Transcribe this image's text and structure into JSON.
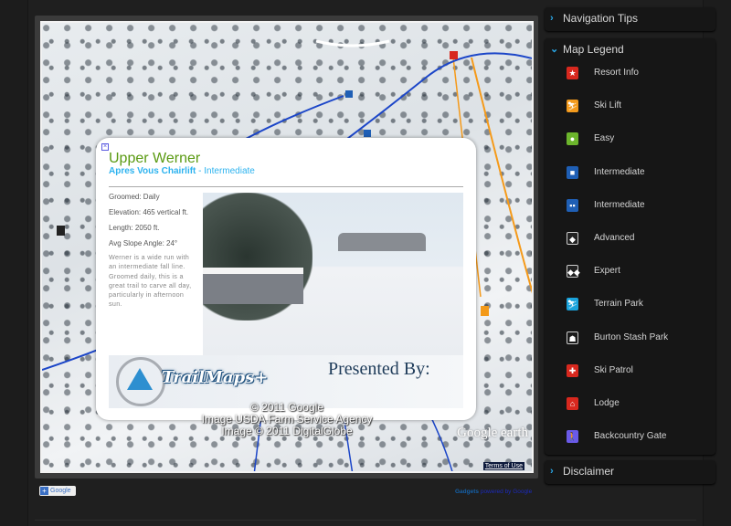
{
  "map": {
    "popup": {
      "close_icon": "close-icon",
      "title": "Upper Werner",
      "lift": "Apres Vous Chairlift",
      "separator": " - ",
      "difficulty": "Intermediate",
      "facts": [
        "Groomed: Daily",
        "Elevation: 465 vertical ft.",
        "Length: 2050 ft.",
        "Avg Slope Angle: 24°"
      ],
      "description": "Werner is a wide run with an intermediate fall line. Groomed daily, this is a great trail to carve all day, particularly in afternoon sun.",
      "banner_logo": "TrailMaps+",
      "presented_by": "Presented By:"
    },
    "attribution": [
      "© 2011 Google",
      "Image USDA Farm Service Agency",
      "Image © 2011 DigitalGlobe"
    ],
    "watermark": "Google earth",
    "terms": "Terms of Use"
  },
  "footer": {
    "add_google": "Google",
    "gadgets": "Gadgets",
    "powered": "powered by Google"
  },
  "sidebar": {
    "navigation_tips": "Navigation Tips",
    "legend_title": "Map Legend",
    "legend": [
      {
        "label": "Resort Info",
        "icon": "star-icon",
        "color": "#d8281e",
        "glyph": "★"
      },
      {
        "label": "Ski Lift",
        "icon": "ski-lift-icon",
        "color": "#f39a1c",
        "glyph": "⛷"
      },
      {
        "label": "Easy",
        "icon": "green-circle-icon",
        "color": "#6cb52c",
        "glyph": "●"
      },
      {
        "label": "Intermediate",
        "icon": "blue-square-icon",
        "color": "#1f5fb5",
        "glyph": "■"
      },
      {
        "label": "Intermediate",
        "icon": "double-blue-square-icon",
        "color": "#1f5fb5",
        "glyph": "▪▪"
      },
      {
        "label": "Advanced",
        "icon": "black-diamond-icon",
        "color": "#222222",
        "glyph": "◆"
      },
      {
        "label": "Expert",
        "icon": "double-black-diamond-icon",
        "color": "#222222",
        "glyph": "◆◆"
      },
      {
        "label": "Terrain Park",
        "icon": "terrain-park-icon",
        "color": "#1aa3dc",
        "glyph": "⛷"
      },
      {
        "label": "Burton Stash Park",
        "icon": "burton-stash-icon",
        "color": "#1a1a1a",
        "glyph": "☗"
      },
      {
        "label": "Ski Patrol",
        "icon": "ski-patrol-icon",
        "color": "#d8281e",
        "glyph": "✚"
      },
      {
        "label": "Lodge",
        "icon": "lodge-icon",
        "color": "#d8281e",
        "glyph": "⌂"
      },
      {
        "label": "Backcountry Gate",
        "icon": "backcountry-gate-icon",
        "color": "#6a5ae8",
        "glyph": "🚶"
      }
    ],
    "disclaimer": "Disclaimer"
  }
}
